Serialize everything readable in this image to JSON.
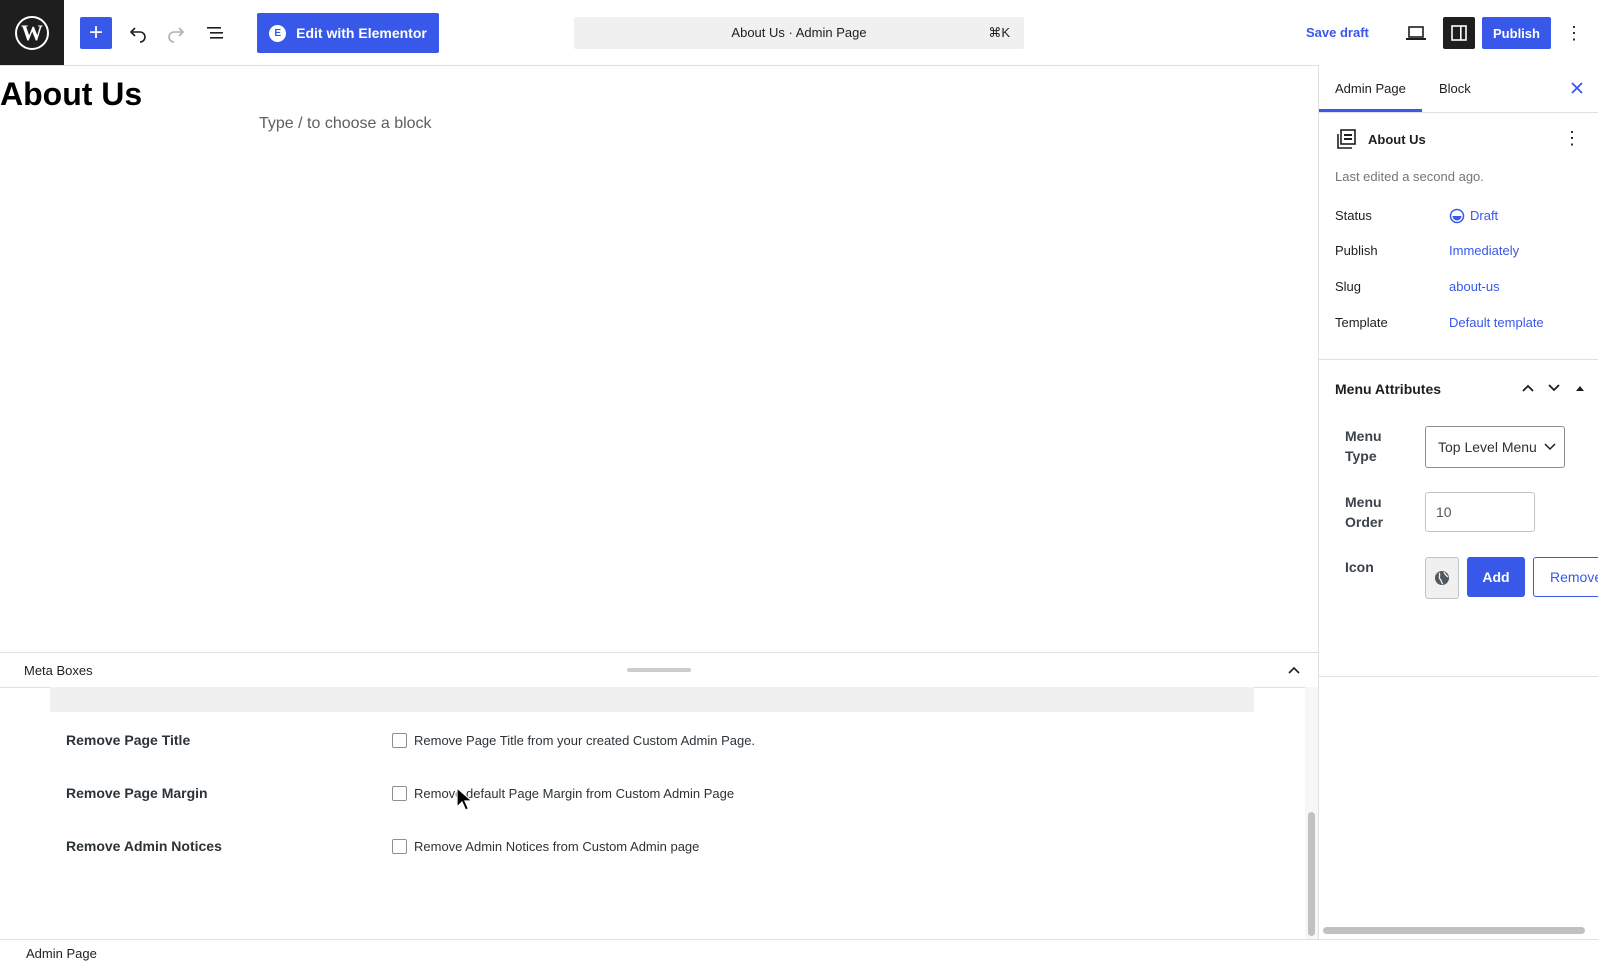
{
  "toolbar": {
    "elementor_label": "Edit with Elementor",
    "command_title": "About Us · Admin Page",
    "command_shortcut": "⌘K",
    "save_draft_label": "Save draft",
    "publish_label": "Publish"
  },
  "editor": {
    "title": "About Us",
    "block_placeholder": "Type / to choose a block"
  },
  "metaboxes": {
    "title": "Meta Boxes",
    "rows": [
      {
        "label": "Remove Page Title",
        "description": "Remove Page Title from your created Custom Admin Page."
      },
      {
        "label": "Remove Page Margin",
        "description": "Remove default Page Margin from Custom Admin Page"
      },
      {
        "label": "Remove Admin Notices",
        "description": "Remove Admin Notices from Custom Admin page"
      }
    ]
  },
  "footer": {
    "breadcrumb": "Admin Page"
  },
  "sidebar": {
    "tabs": [
      "Admin Page",
      "Block"
    ],
    "post_title": "About Us",
    "last_edited": "Last edited a second ago.",
    "rows": [
      {
        "label": "Status",
        "value": "Draft"
      },
      {
        "label": "Publish",
        "value": "Immediately"
      },
      {
        "label": "Slug",
        "value": "about-us"
      },
      {
        "label": "Template",
        "value": "Default template"
      }
    ],
    "menu_attributes": {
      "title": "Menu Attributes",
      "menu_type_label": "Menu Type",
      "menu_type_value": "Top Level Menu",
      "menu_order_label": "Menu Order",
      "menu_order_value": "10",
      "icon_label": "Icon",
      "add_label": "Add",
      "remove_label": "Remove"
    }
  },
  "colors": {
    "accent": "#3858e9",
    "dark": "#1e1e1e"
  }
}
